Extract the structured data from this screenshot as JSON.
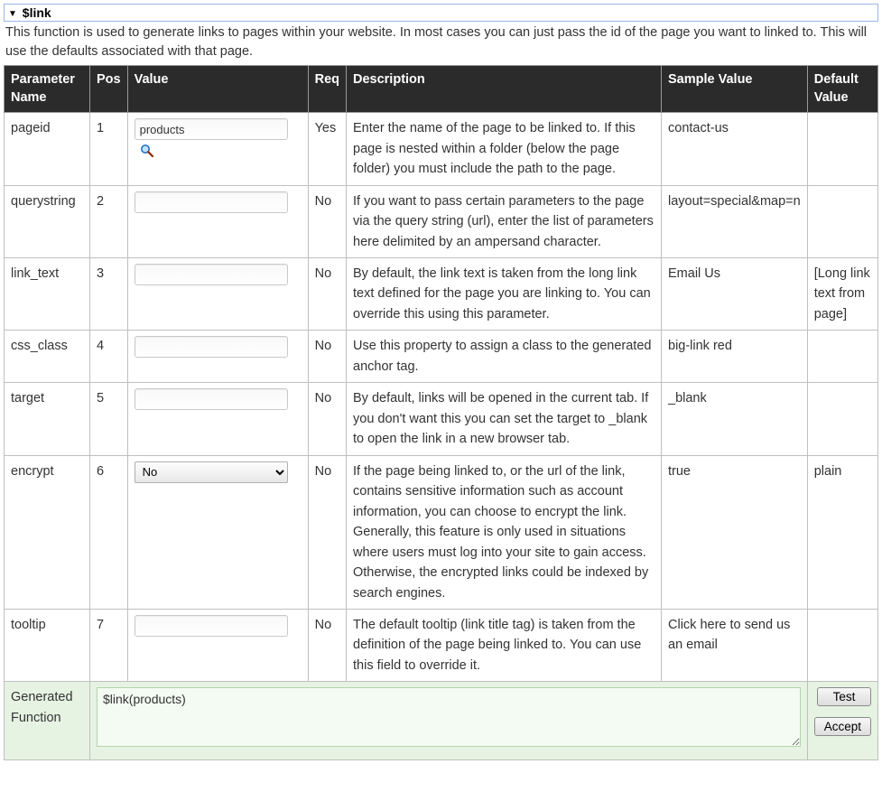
{
  "title": "$link",
  "intro": "This function is used to generate links to pages within your website. In most cases you can just pass the id of the page you want to linked to. This will use the defaults associated with that page.",
  "headers": {
    "pname": "Parameter Name",
    "pos": "Pos",
    "value": "Value",
    "req": "Req",
    "desc": "Description",
    "sample": "Sample Value",
    "default": "Default Value"
  },
  "rows": [
    {
      "pname": "pageid",
      "pos": "1",
      "input_type": "text",
      "value": "products",
      "has_lookup": true,
      "req": "Yes",
      "desc": "Enter the name of the page to be linked to. If this page is nested within a folder (below the page folder) you must include the path to the page.",
      "sample": "contact-us",
      "default": ""
    },
    {
      "pname": "querystring",
      "pos": "2",
      "input_type": "text",
      "value": "",
      "req": "No",
      "desc": "If you want to pass certain parameters to the page via the query string (url), enter the list of parameters here delimited by an ampersand character.",
      "sample": "layout=special&map=n",
      "default": ""
    },
    {
      "pname": "link_text",
      "pos": "3",
      "input_type": "text",
      "value": "",
      "req": "No",
      "desc": "By default, the link text is taken from the long link text defined for the page you are linking to. You can override this using this parameter.",
      "sample": "Email Us",
      "default": "[Long link text from page]"
    },
    {
      "pname": "css_class",
      "pos": "4",
      "input_type": "text",
      "value": "",
      "req": "No",
      "desc": "Use this property to assign a class to the generated anchor tag.",
      "sample": "big-link red",
      "default": ""
    },
    {
      "pname": "target",
      "pos": "5",
      "input_type": "text",
      "value": "",
      "req": "No",
      "desc": "By default, links will be opened in the current tab. If you don't want this you can set the target to _blank to open the link in a new browser tab.",
      "sample": "_blank",
      "default": ""
    },
    {
      "pname": "encrypt",
      "pos": "6",
      "input_type": "select",
      "value": "No",
      "req": "No",
      "desc": "If the page being linked to, or the url of the link, contains sensitive information such as account information, you can choose to encrypt the link. Generally, this feature is only used in situations where users must log into your site to gain access. Otherwise, the encrypted links could be indexed by search engines.",
      "sample": "true",
      "default": "plain"
    },
    {
      "pname": "tooltip",
      "pos": "7",
      "input_type": "text",
      "value": "",
      "req": "No",
      "desc": "The default tooltip (link title tag) is taken from the definition of the page being linked to. You can use this field to override it.",
      "sample": "Click here to send us an email",
      "default": ""
    }
  ],
  "generated": {
    "label": "Generated Function",
    "value": "$link(products)"
  },
  "buttons": {
    "test": "Test",
    "accept": "Accept"
  }
}
